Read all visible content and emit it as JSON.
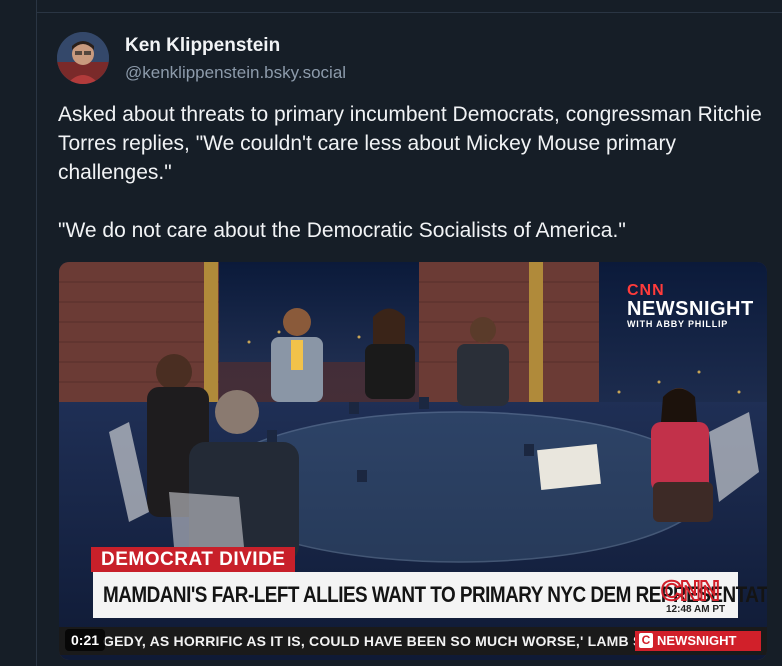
{
  "author": {
    "name": "Ken Klippenstein",
    "handle": "@kenklippenstein.bsky.social"
  },
  "post": {
    "paragraphs": [
      "Asked about threats to primary incumbent Democrats, congressman Ritchie Torres replies, \"We couldn't care less about Mickey Mouse primary challenges.\"",
      "\"We do not care about the Democratic Socialists of America.\""
    ]
  },
  "video": {
    "wall_brand": {
      "network": "CNN",
      "show": "NEWSNIGHT",
      "subtitle": "WITH ABBY PHILLIP"
    },
    "kicker": "DEMOCRAT DIVIDE",
    "headline": "MAMDANI'S FAR-LEFT ALLIES WANT TO PRIMARY NYC DEM REPRESENTATIVES",
    "logo_text": "CNN",
    "clock": "12:48 AM PT",
    "ticker": "GEDY, AS HORRIFIC AS IT IS, COULD HAVE BEEN SO MUCH WORSE,' LAMB SAID.",
    "ticker_logo": "C",
    "ticker_brand": "NEWSNIGHT",
    "timestamp": "0:21"
  },
  "colors": {
    "background": "#161e27",
    "cnn_red": "#c8202a",
    "handle_gray": "#8d9bab"
  }
}
